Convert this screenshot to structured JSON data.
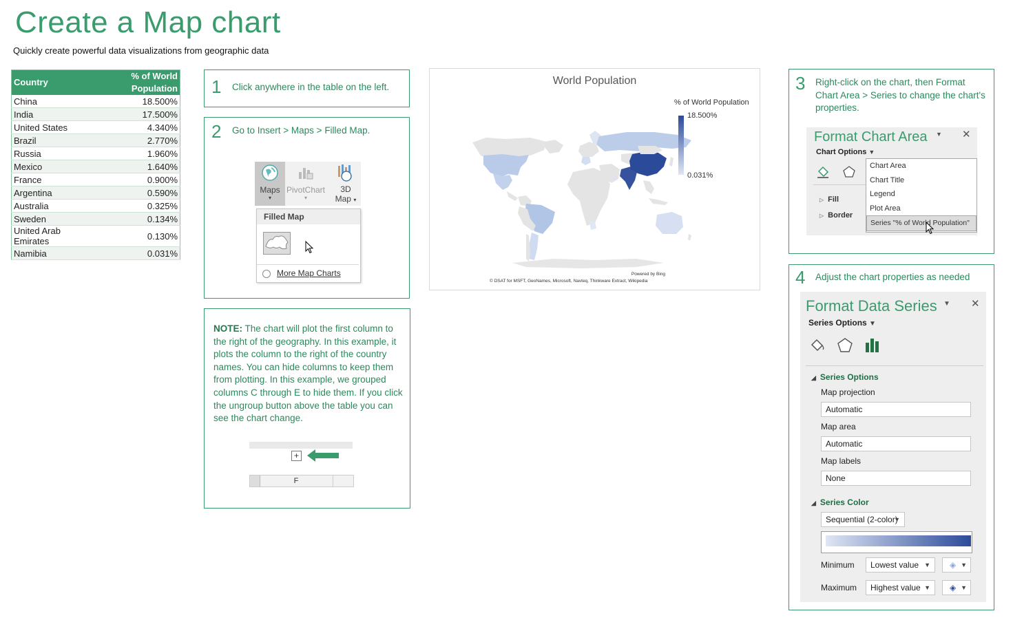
{
  "page": {
    "title": "Create a Map chart",
    "subtitle": "Quickly create powerful data visualizations from geographic data"
  },
  "table": {
    "headers": [
      "Country",
      "% of World Population"
    ],
    "rows": [
      {
        "country": "China",
        "value": "18.500%"
      },
      {
        "country": "India",
        "value": "17.500%"
      },
      {
        "country": "United States",
        "value": "4.340%"
      },
      {
        "country": "Brazil",
        "value": "2.770%"
      },
      {
        "country": "Russia",
        "value": "1.960%"
      },
      {
        "country": "Mexico",
        "value": "1.640%"
      },
      {
        "country": "France",
        "value": "0.900%"
      },
      {
        "country": "Argentina",
        "value": "0.590%"
      },
      {
        "country": "Australia",
        "value": "0.325%"
      },
      {
        "country": "Sweden",
        "value": "0.134%"
      },
      {
        "country": "United Arab Emirates",
        "value": "0.130%"
      },
      {
        "country": "Namibia",
        "value": "0.031%"
      }
    ]
  },
  "steps": {
    "s1": {
      "num": "1",
      "text": "Click anywhere in the table on the left."
    },
    "s2": {
      "num": "2",
      "text": "Go to Insert > Maps > Filled Map.",
      "ribbon": {
        "maps": "Maps",
        "pivot": "PivotChart",
        "map3d_a": "3D",
        "map3d_b": "Map"
      },
      "menu": {
        "header": "Filled Map",
        "more": "More Map Charts"
      }
    },
    "note": {
      "label": "NOTE:",
      "text": "The chart will plot the first column to the right of the geography. In this example, it plots the column to the right of the country names. You can hide columns to keep them from plotting. In this example, we grouped columns C through E to hide them. If you click the ungroup button above the table you can see the chart change.",
      "plus": "+",
      "col": "F"
    },
    "s3": {
      "num": "3",
      "text": "Right-click on the chart, then Format Chart Area > Series to change the chart's properties."
    },
    "s4": {
      "num": "4",
      "text": "Adjust the chart properties as needed"
    }
  },
  "chart": {
    "title": "World Population",
    "legend_title": "% of World Population",
    "legend_max": "18.500%",
    "legend_min": "0.031%",
    "powered": "Powered by Bing",
    "credits": "© DSAT for MSFT, GeoNames, Microsoft, Navteq, Thinkware Extract, Wikipedia",
    "color_min": "#dfe6f4",
    "color_max": "#2b4a9a"
  },
  "chart_data": {
    "type": "map",
    "title": "World Population",
    "legend": "% of World Population",
    "regions": [
      "China",
      "India",
      "United States",
      "Brazil",
      "Russia",
      "Mexico",
      "France",
      "Argentina",
      "Australia",
      "Sweden",
      "United Arab Emirates",
      "Namibia"
    ],
    "values": [
      18.5,
      17.5,
      4.34,
      2.77,
      1.96,
      1.64,
      0.9,
      0.59,
      0.325,
      0.134,
      0.13,
      0.031
    ],
    "range": [
      0.031,
      18.5
    ]
  },
  "format_chart_area": {
    "title": "Format Chart Area",
    "options": "Chart Options",
    "fill": "Fill",
    "border": "Border",
    "dropdown_items": [
      "Chart Area",
      "Chart Title",
      "Legend",
      "Plot Area",
      "Series \"% of World Population\""
    ]
  },
  "format_data_series": {
    "title": "Format Data Series",
    "options": "Series Options",
    "section1": "Series Options",
    "map_projection_label": "Map projection",
    "map_projection_value": "Automatic",
    "map_area_label": "Map area",
    "map_area_value": "Automatic",
    "map_labels_label": "Map labels",
    "map_labels_value": "None",
    "section2": "Series Color",
    "color_scheme": "Sequential (2-color)",
    "minimum_label": "Minimum",
    "minimum_value": "Lowest value",
    "maximum_label": "Maximum",
    "maximum_value": "Highest value"
  },
  "colors": {
    "accent": "#3a9b6d",
    "map_dark": "#2b4a9a",
    "map_light": "#dfe6f4"
  }
}
